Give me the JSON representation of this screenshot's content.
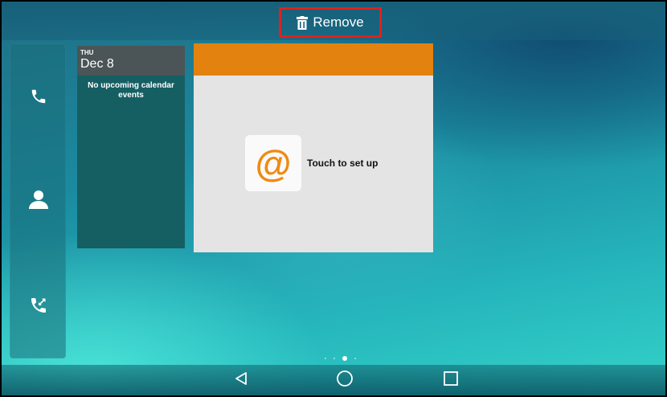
{
  "top_bar": {
    "remove_label": "Remove"
  },
  "dock": {
    "items": [
      "phone-icon",
      "contacts-icon",
      "call-transfer-icon"
    ]
  },
  "calendar_widget": {
    "day_of_week": "THU",
    "date": "Dec 8",
    "empty_message": "No upcoming calendar events"
  },
  "email_widget": {
    "icon_glyph": "@",
    "label": "Touch to set up",
    "accent_color": "#e4820f"
  },
  "page_indicator": {
    "total": 4,
    "current": 3
  },
  "nav_bar": {
    "items": [
      "back-icon",
      "home-icon",
      "recents-icon"
    ]
  },
  "colors": {
    "highlight_border": "#e0211d"
  }
}
